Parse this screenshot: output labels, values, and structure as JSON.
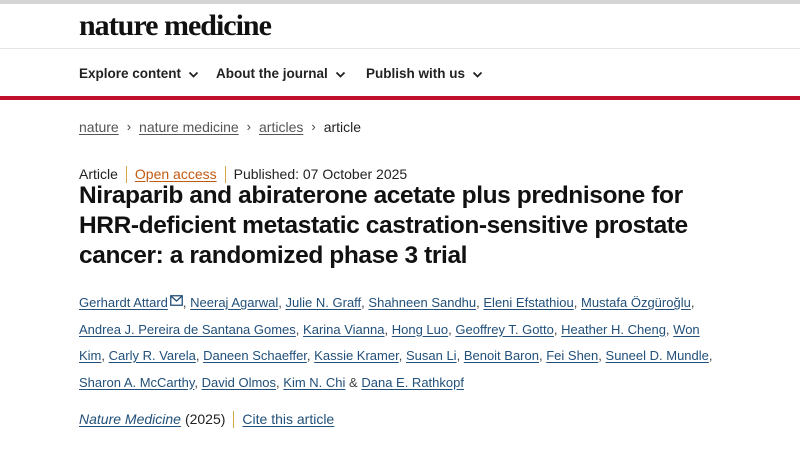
{
  "site": {
    "logo": "nature medicine"
  },
  "nav": {
    "items": [
      {
        "label": "Explore content"
      },
      {
        "label": "About the journal"
      },
      {
        "label": "Publish with us"
      }
    ]
  },
  "breadcrumb": {
    "items": [
      "nature",
      "nature medicine",
      "articles"
    ],
    "current": "article",
    "separator": "›"
  },
  "article": {
    "type": "Article",
    "access": "Open access",
    "published": "Published: 07 October 2025",
    "title": "Niraparib and abiraterone acetate plus prednisone for HRR-deficient metastatic castration-sensitive prostate cancer: a randomized phase 3 trial",
    "authors": [
      "Gerhardt Attard",
      "Neeraj Agarwal",
      "Julie N. Graff",
      "Shahneen Sandhu",
      "Eleni Efstathiou",
      "Mustafa Özgüroğlu",
      "Andrea J. Pereira de Santana Gomes",
      "Karina Vianna",
      "Hong Luo",
      "Geoffrey T. Gotto",
      "Heather H. Cheng",
      "Won Kim",
      "Carly R. Varela",
      "Daneen Schaeffer",
      "Kassie Kramer",
      "Susan Li",
      "Benoit Baron",
      "Fei Shen",
      "Suneel D. Mundle",
      "Sharon A. McCarthy",
      "David Olmos",
      "Kim N. Chi",
      "Dana E. Rathkopf"
    ],
    "author_separator": ",",
    "last_author_joiner": "&",
    "journal": "Nature Medicine",
    "year": "(2025)",
    "cite_label": "Cite this article"
  },
  "colors": {
    "accent_red": "#c0102d",
    "link_blue": "#22507a",
    "open_access_orange": "#c35a12"
  },
  "icons": [
    "chevron-down-icon",
    "mail-icon"
  ]
}
